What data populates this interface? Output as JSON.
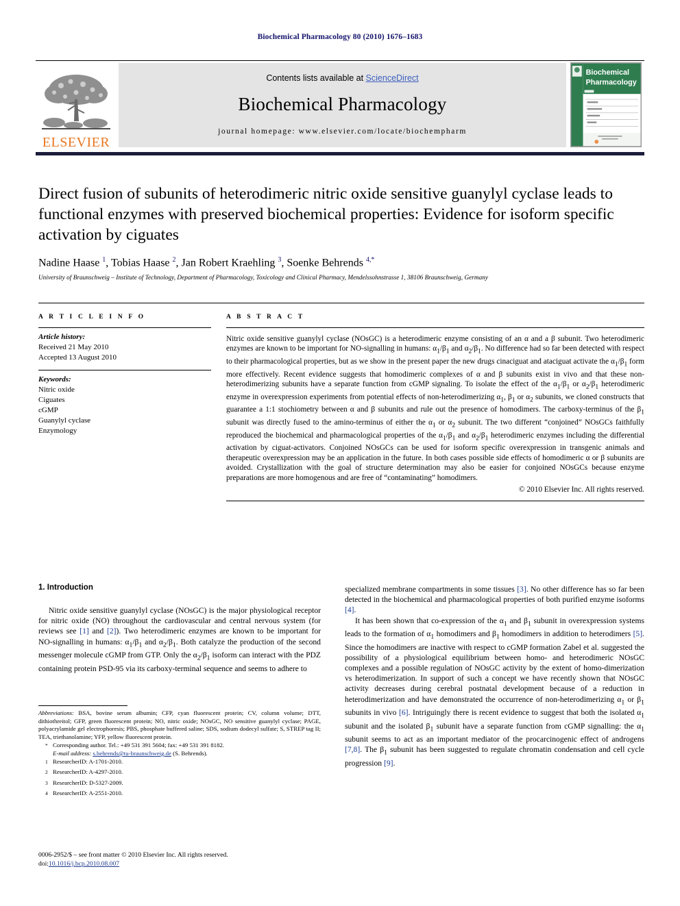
{
  "running_head": "Biochemical Pharmacology 80 (2010) 1676–1683",
  "masthead": {
    "publisher_wordmark": "ELSEVIER",
    "contents_prefix": "Contents lists available at ",
    "sciencedirect": "ScienceDirect",
    "journal_title": "Biochemical Pharmacology",
    "homepage": "journal homepage: www.elsevier.com/locate/biochempharm",
    "cover_title_line1": "Biochemical",
    "cover_title_line2": "Pharmacology",
    "accent_orange": "#e87722",
    "accent_link_blue": "#3c5fbe",
    "cover_green": "#2f7d4f"
  },
  "article": {
    "title": "Direct fusion of subunits of heterodimeric nitric oxide sensitive guanylyl cyclase leads to functional enzymes with preserved biochemical properties: Evidence for isoform specific activation by ciguates",
    "authors_html": "Nadine Haase <sup>1</sup>, Tobias Haase <sup>2</sup>, Jan Robert Kraehling <sup>3</sup>, Soenke Behrends <sup>4,*</sup>",
    "affiliation": "University of Braunschweig – Institute of Technology, Department of Pharmacology, Toxicology and Clinical Pharmacy, Mendelssohnstrasse 1, 38106 Braunschweig, Germany"
  },
  "article_info": {
    "label": "A R T I C L E   I N F O",
    "history_label": "Article history:",
    "history": [
      "Received 21 May 2010",
      "Accepted 13 August 2010"
    ],
    "keywords_label": "Keywords:",
    "keywords": [
      "Nitric oxide",
      "Ciguates",
      "cGMP",
      "Guanylyl cyclase",
      "Enzymology"
    ]
  },
  "abstract": {
    "label": "A B S T R A C T",
    "text_html": "Nitric oxide sensitive guanylyl cyclase (NOsGC) is a heterodimeric enzyme consisting of an &alpha; and a &beta; subunit. Two heterodimeric enzymes are known to be important for NO-signalling in humans: &alpha;<sub>1</sub>/&beta;<sub>1</sub> and &alpha;<sub>2</sub>/&beta;<sub>1</sub>. No difference had so far been detected with respect to their pharmacological properties, but as we show in the present paper the new drugs cinaciguat and ataciguat activate the &alpha;<sub>1</sub>/&beta;<sub>1</sub> form more effectively. Recent evidence suggests that homodimeric complexes of &alpha; and &beta; subunits exist in vivo and that these non-heterodimerizing subunits have a separate function from cGMP signaling. To isolate the effect of the &alpha;<sub>1</sub>/&beta;<sub>1</sub> or &alpha;<sub>2</sub>/&beta;<sub>1</sub> heterodimeric enzyme in overexpression experiments from potential effects of non-heterodimerizing &alpha;<sub>1</sub>, &beta;<sub>1</sub> or &alpha;<sub>2</sub> subunits, we cloned constructs that guarantee a 1:1 stochiometry between &alpha; and &beta; subunits and rule out the presence of homodimers. The carboxy-terminus of the &beta;<sub>1</sub> subunit was directly fused to the amino-terminus of either the &alpha;<sub>1</sub> or &alpha;<sub>2</sub> subunit. The two different &ldquo;conjoined&rdquo; NOsGCs faithfully reproduced the biochemical and pharmacological properties of the &alpha;<sub>1</sub>/&beta;<sub>1</sub> and &alpha;<sub>2</sub>/&beta;<sub>1</sub> heterodimeric enzymes including the differential activation by ciguat-activators. Conjoined NOsGCs can be used for isoform specific overexpression in transgenic animals and therapeutic overexpression may be an application in the future. In both cases possible side effects of homodimeric &alpha; or &beta; subunits are avoided. Crystallization with the goal of structure determination may also be easier for conjoined NOsGCs because enzyme preparations are more homogenous and are free of &ldquo;contaminating&rdquo; homodimers.",
    "copyright": "© 2010 Elsevier Inc. All rights reserved."
  },
  "body": {
    "section_heading": "1. Introduction",
    "left_column_html": "<p class=\"indent\">Nitric oxide sensitive guanylyl cyclase (NOsGC) is the major physiological receptor for nitric oxide (NO) throughout the cardiovascular and central nervous system (for reviews see <span class=\"ref\">[1]</span> and <span class=\"ref\">[2]</span>). Two heterodimeric enzymes are known to be important for NO-signalling in humans: &alpha;<sub>1</sub>/&beta;<sub>1</sub> and &alpha;<sub>2</sub>/&beta;<sub>1</sub>. Both catalyze the production of the second messenger molecule cGMP from GTP. Only the &alpha;<sub>2</sub>/&beta;<sub>1</sub> isoform can interact with the PDZ containing protein PSD-95 via its carboxy-terminal sequence and seems to adhere to</p>",
    "right_column_html": "<p>specialized membrane compartments in some tissues <span class=\"ref\">[3]</span>. No other difference has so far been detected in the biochemical and pharmacological properties of both purified enzyme isoforms <span class=\"ref\">[4]</span>.</p><p class=\"indent\">It has been shown that co-expression of the &alpha;<sub>1</sub> and &beta;<sub>1</sub> subunit in overexpression systems leads to the formation of &alpha;<sub>1</sub> homodimers and &beta;<sub>1</sub> homodimers in addition to heterodimers <span class=\"ref\">[5]</span>. Since the homodimers are inactive with respect to cGMP formation Zabel et al. suggested the possibility of a physiological equilibrium between homo- and heterodimeric NOsGC complexes and a possible regulation of NOsGC activity by the extent of homo-dimerization vs heterodimerization. In support of such a concept we have recently shown that NOsGC activity decreases during cerebral postnatal development because of a reduction in heterodimerization and have demonstrated the occurrence of non-heterodimerizing &alpha;<sub>1</sub> or &beta;<sub>1</sub> subunits in vivo <span class=\"ref\">[6]</span>. Intriguingly there is recent evidence to suggest that both the isolated &alpha;<sub>1</sub> subunit and the isolated &beta;<sub>1</sub> subunit have a separate function from cGMP signalling: the &alpha;<sub>1</sub> subunit seems to act as an important mediator of the procarcinogenic effect of androgens <span class=\"ref\">[7,8]</span>. The &beta;<sub>1</sub> subunit has been suggested to regulate chromatin condensation and cell cycle progression <span class=\"ref\">[9]</span>.</p>"
  },
  "footnotes": {
    "abbreviations_html": "<i>Abbreviations:</i> BSA, bovine serum albumin; CFP, cyan fluorescent protein; CV, column volume; DTT, dithiothreitol; GFP, green fluorescent protein; NO, nitric oxide; NOsGC, NO sensitive guanylyl cyclase; PAGE, polyacrylamide gel electrophoresis; PBS, phosphate buffered saline; SDS, sodium dodecyl sulfate; S, STREP tag II; TEA, triethanolamine; YFP, yellow fluorescent protein.",
    "corresponding_marker": "*",
    "corresponding_text": "Corresponding author. Tel.: +49 531 391 5604; fax: +49 531 391 8182.",
    "email_label": "E-mail address:",
    "email_address": "s.behrends@tu-braunschweig.de",
    "email_suffix": "(S. Behrends).",
    "researcher_ids": [
      {
        "marker": "1",
        "text": "ResearcherID: A-1701-2010."
      },
      {
        "marker": "2",
        "text": "ResearcherID: A-4297-2010."
      },
      {
        "marker": "3",
        "text": "ResearcherID: D-5327-2009."
      },
      {
        "marker": "4",
        "text": "ResearcherID: A-2551-2010."
      }
    ]
  },
  "frontmatter": {
    "line1": "0006-2952/$ – see front matter © 2010 Elsevier Inc. All rights reserved.",
    "doi_label": "doi:",
    "doi_value": "10.1016/j.bcp.2010.08.007"
  }
}
